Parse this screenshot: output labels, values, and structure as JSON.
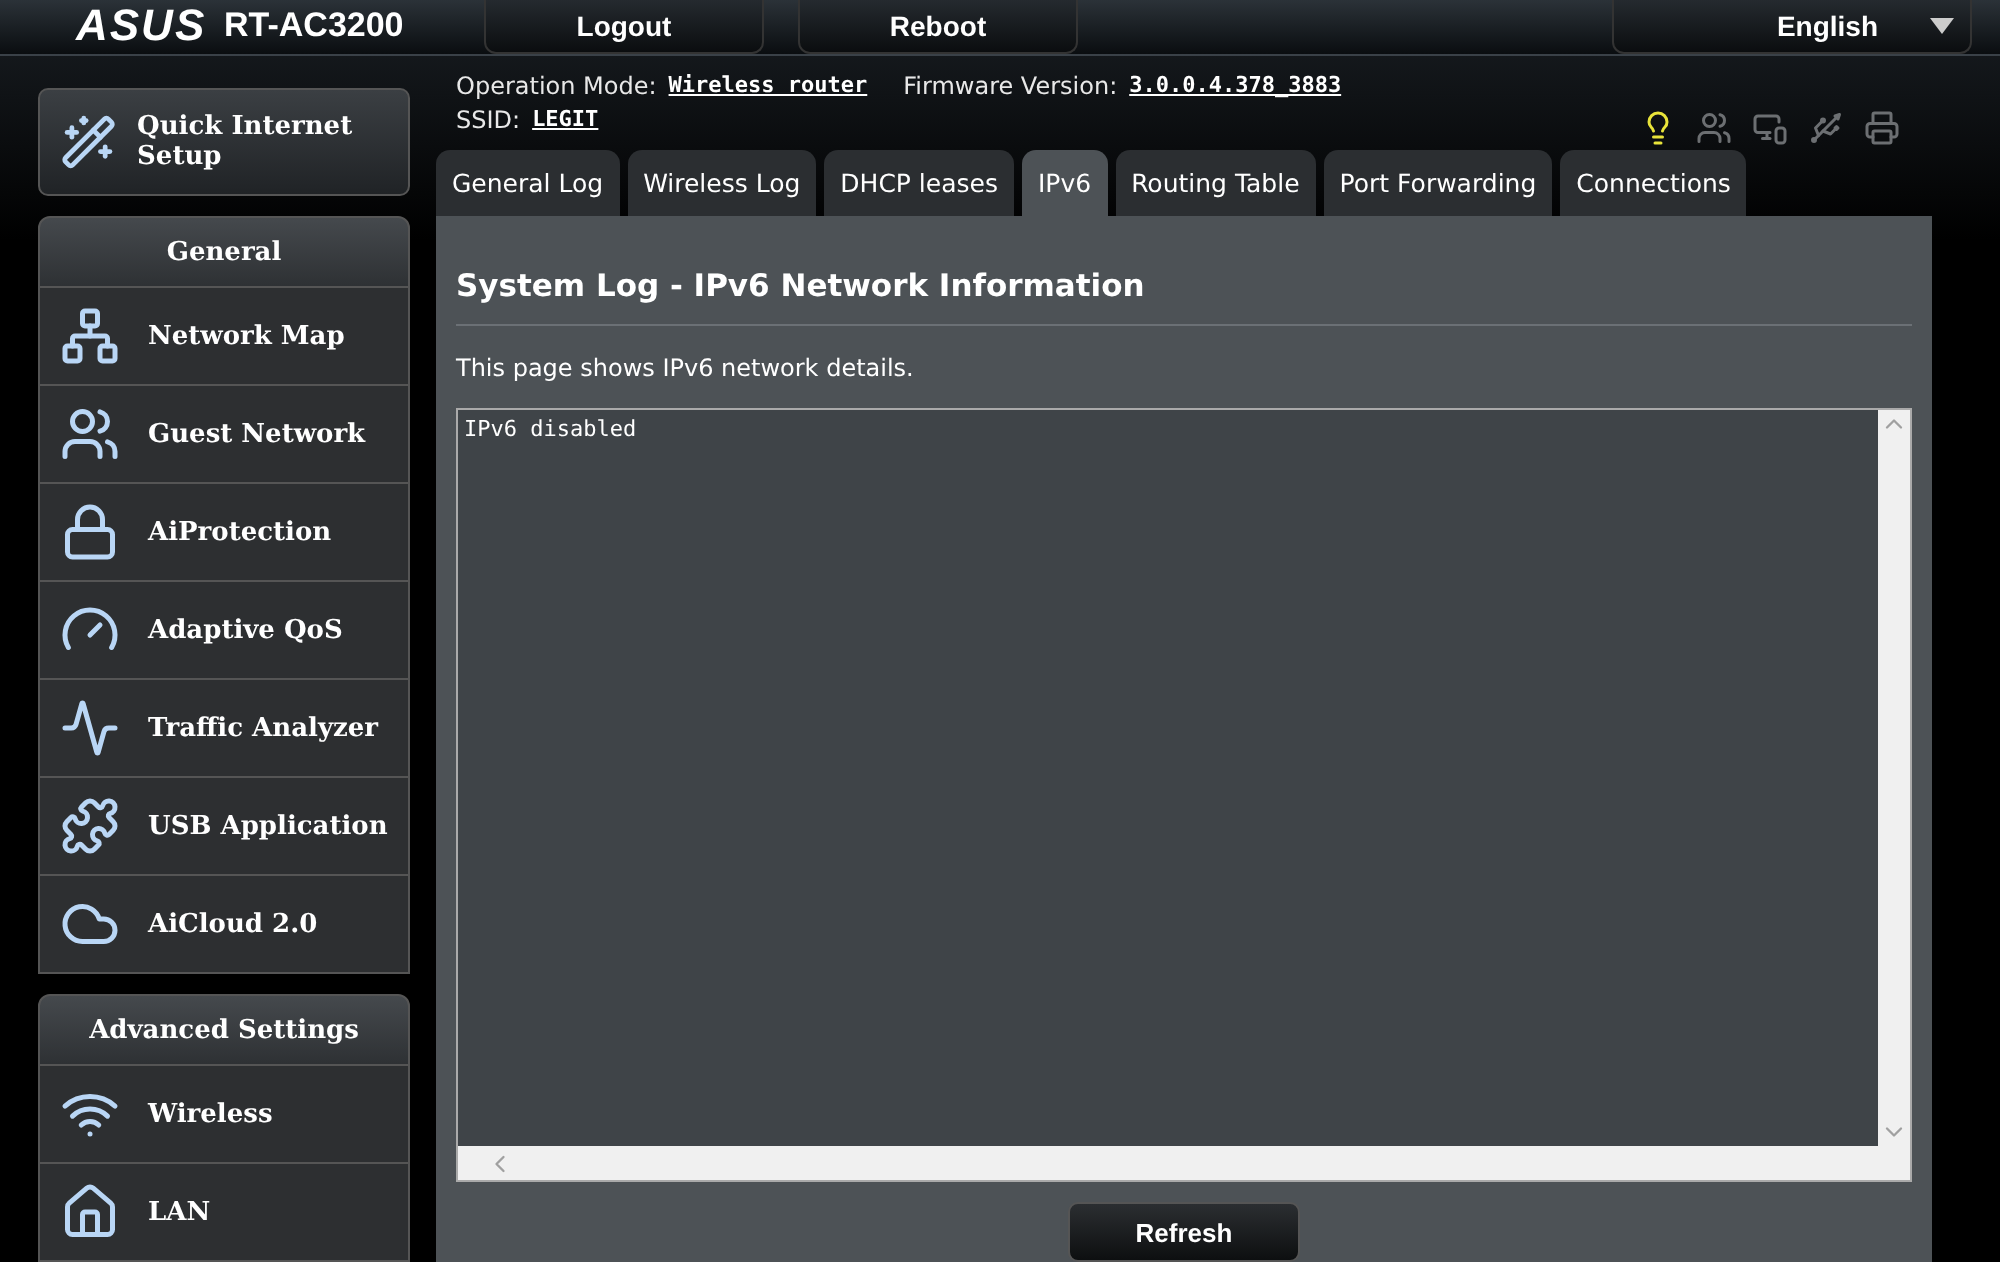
{
  "header": {
    "logo": "ASUS",
    "model": "RT-AC3200",
    "buttons": [
      "Logout",
      "Reboot"
    ],
    "language": "English"
  },
  "quick_setup": {
    "label": "Quick Internet Setup"
  },
  "sidebar": [
    {
      "title": "General",
      "items": [
        {
          "label": "Network Map",
          "selected": false
        },
        {
          "label": "Guest Network",
          "selected": false
        },
        {
          "label": "AiProtection",
          "selected": false
        },
        {
          "label": "Adaptive QoS",
          "selected": false
        },
        {
          "label": "Traffic Analyzer",
          "selected": false
        },
        {
          "label": "USB Application",
          "selected": false
        },
        {
          "label": "AiCloud 2.0",
          "selected": false
        }
      ]
    },
    {
      "title": "Advanced Settings",
      "items": [
        {
          "label": "Wireless",
          "selected": false
        },
        {
          "label": "LAN",
          "selected": false
        }
      ]
    }
  ],
  "info": {
    "mode_label": "Operation Mode:",
    "mode": "Wireless router",
    "fw_label": "Firmware Version:",
    "fw": "3.0.0.4.378_3883",
    "ssid_label": "SSID:",
    "ssid": "LEGIT"
  },
  "status_icons": [
    {
      "kind": "bulb",
      "on": true
    },
    {
      "kind": "clients",
      "on": false
    },
    {
      "kind": "devices",
      "on": false
    },
    {
      "kind": "usb",
      "on": false
    },
    {
      "kind": "printer",
      "on": false
    }
  ],
  "tabs": [
    {
      "label": "General Log",
      "selected": false
    },
    {
      "label": "Wireless Log",
      "selected": false
    },
    {
      "label": "DHCP leases",
      "selected": false
    },
    {
      "label": "IPv6",
      "selected": true
    },
    {
      "label": "Routing Table",
      "selected": false
    },
    {
      "label": "Port Forwarding",
      "selected": false
    },
    {
      "label": "Connections",
      "selected": false
    }
  ],
  "panel": {
    "title": "System Log - IPv6 Network Information",
    "description": "This page shows IPv6 network details.",
    "log": "IPv6 disabled",
    "button": "Refresh"
  }
}
